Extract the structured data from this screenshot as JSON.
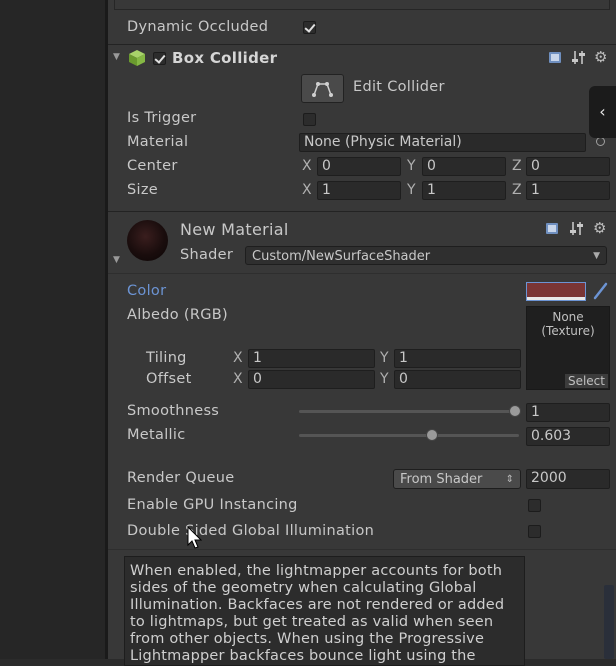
{
  "prev_component": {
    "dynamic_occluded_label": "Dynamic Occluded",
    "dynamic_occluded_checked": true
  },
  "box_collider": {
    "title": "Box Collider",
    "edit_collider_label": "Edit Collider",
    "is_trigger_label": "Is Trigger",
    "material_label": "Material",
    "material_value": "None (Physic Material)",
    "center_label": "Center",
    "center": {
      "x": "0",
      "y": "0",
      "z": "0"
    },
    "size_label": "Size",
    "size": {
      "x": "1",
      "y": "1",
      "z": "1"
    },
    "axis_x": "X",
    "axis_y": "Y",
    "axis_z": "Z"
  },
  "material": {
    "name": "New Material",
    "shader_label": "Shader",
    "shader_value": "Custom/NewSurfaceShader",
    "color_label": "Color",
    "color_swatch": "#7a3535",
    "albedo_label": "Albedo (RGB)",
    "texture_none": "None",
    "texture_type": "(Texture)",
    "select_label": "Select",
    "tiling_label": "Tiling",
    "tiling": {
      "x": "1",
      "y": "1"
    },
    "offset_label": "Offset",
    "offset": {
      "x": "0",
      "y": "0"
    },
    "smoothness_label": "Smoothness",
    "smoothness_value": "1",
    "smoothness_fraction": 1.0,
    "metallic_label": "Metallic",
    "metallic_value": "0.603",
    "metallic_fraction": 0.603,
    "render_queue_label": "Render Queue",
    "render_queue_mode": "From Shader",
    "render_queue_value": "2000",
    "gpu_instancing_label": "Enable GPU Instancing",
    "double_sided_gi_label": "Double Sided Global Illumination",
    "help_text": "When enabled, the lightmapper accounts for both sides of the geometry when calculating Global Illumination. Backfaces are not rendered or added to lightmaps, but get treated as valid when seen from other objects. When using the Progressive Lightmapper backfaces bounce light using the"
  },
  "side_tab_icon": "chevron-left-icon",
  "colors": {
    "accent_blue": "#6c94d4",
    "panel": "#383838"
  }
}
